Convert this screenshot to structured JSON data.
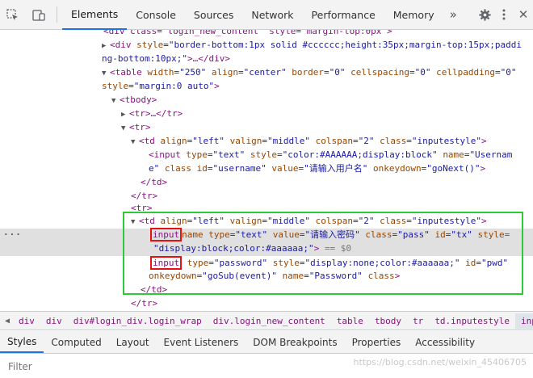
{
  "toolbar": {
    "tabs": [
      "Elements",
      "Console",
      "Sources",
      "Network",
      "Performance",
      "Memory"
    ],
    "more": "»",
    "inspect_icon": "inspect-cursor-icon",
    "device_icon": "device-toolbar-icon",
    "settings_icon": "gear-icon",
    "menu_icon": "kebab-menu-icon",
    "close_label": "✕"
  },
  "dom": {
    "l0_text": "<div class=\"login_new_content\" style=\"margin-top:0px\">",
    "l1_open": "<div",
    "l1_an": "style",
    "l1_av": "\"border-bottom:1px solid #cccccc;height:35px;margin-top:15px;paddi",
    "l2_av": "ng-bottom:10px;\"",
    "l2_rest": ">…</div>",
    "l3_open": "<table",
    "l3_a1": "width",
    "l3_v1": "\"250\"",
    "l3_a2": "align",
    "l3_v2": "\"center\"",
    "l3_a3": "border",
    "l3_v3": "\"0\"",
    "l3_a4": "cellspacing",
    "l3_v4": "\"0\"",
    "l3_a5": "cellpadding",
    "l3_v5": "\"0\"",
    "l4_an": "style",
    "l4_av": "\"margin:0 auto\"",
    "l4_close": ">",
    "l5": "<tbody>",
    "l6": "<tr>…</tr>",
    "l7": "<tr>",
    "l8_open": "<td",
    "l8_a1": "align",
    "l8_v1": "\"left\"",
    "l8_a2": "valign",
    "l8_v2": "\"middle\"",
    "l8_a3": "colspan",
    "l8_v3": "\"2\"",
    "l8_a4": "class",
    "l8_v4": "\"inputestyle\"",
    "l8_close": ">",
    "l9_open": "<input",
    "l9_a1": "type",
    "l9_v1": "\"text\"",
    "l9_a2": "style",
    "l9_v2": "\"color:#AAAAAA;display:block\"",
    "l9_a3": "name",
    "l9_v3": "\"Usernam",
    "l10_v3": "e\"",
    "l10_a4": "class",
    "l10_a5": "id",
    "l10_v5": "\"username\"",
    "l10_a6": "value",
    "l10_v6": "\"请输入用户名\"",
    "l10_a7": "onkeydown",
    "l10_v7": "\"goNext()\"",
    "l10_close": ">",
    "l11": "</td>",
    "l12": "</tr>",
    "l13": "<tr>",
    "l14_open": "<td",
    "l14_a1": "align",
    "l14_v1": "\"left\"",
    "l14_a2": "valign",
    "l14_v2": "\"middle\"",
    "l14_a3": "colspan",
    "l14_v3": "\"2\"",
    "l14_a4": "class",
    "l14_v4": "\"inputestyle\"",
    "l14_close": ">",
    "l15_tag": "input",
    "l15_a1": "name",
    "l15_a2": "type",
    "l15_v2": "\"text\"",
    "l15_a3": "value",
    "l15_v3": "\"请输入密码\"",
    "l15_a4": "class",
    "l15_v4": "\"pass\"",
    "l15_a5": "id",
    "l15_v5": "\"tx\"",
    "l15_a6": "style=",
    "l16_v6": "\"display:block;color:#aaaaaa;\"",
    "l16_close": ">",
    "l16_dollar": "== $0",
    "l17_tag": "input",
    "l17_a1": "type",
    "l17_v1": "\"password\"",
    "l17_a2": "style",
    "l17_v2": "\"display:none;color:#aaaaaa;\"",
    "l17_a3": "id",
    "l17_v3": "\"pwd\"",
    "l18_a4": "onkeydown",
    "l18_v4": "\"goSub(event)\"",
    "l18_a5": "name",
    "l18_v5": "\"Password\"",
    "l18_a6": "class",
    "l18_close": ">",
    "l19": "</td>",
    "l20": "</tr>"
  },
  "breadcrumb": [
    "div",
    "div",
    "div#login_div.login_wrap",
    "div.login_new_content",
    "table",
    "tbody",
    "tr",
    "td.inputestyle",
    "input#tx.pass"
  ],
  "subtabs": [
    "Styles",
    "Computed",
    "Layout",
    "Event Listeners",
    "DOM Breakpoints",
    "Properties",
    "Accessibility"
  ],
  "filter": {
    "placeholder": "Filter"
  },
  "watermark": "https://blog.csdn.net/weixin_45406705"
}
